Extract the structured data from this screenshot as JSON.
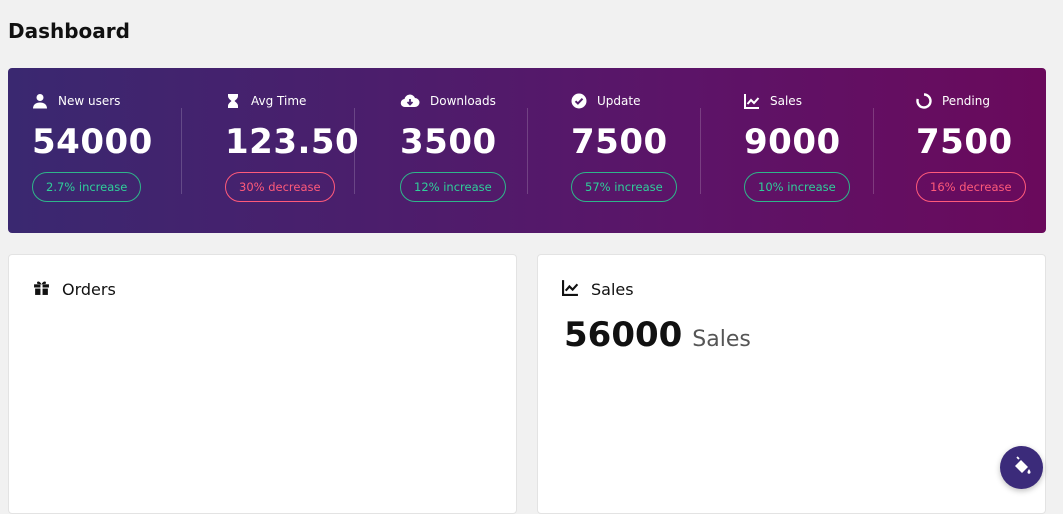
{
  "header": {
    "title": "Dashboard"
  },
  "stats": [
    {
      "icon": "user-icon",
      "label": "New users",
      "value": "54000",
      "badge": "2.7% increase",
      "trend": "up"
    },
    {
      "icon": "hourglass-icon",
      "label": "Avg Time",
      "value": "123.50",
      "badge": "30% decrease",
      "trend": "down"
    },
    {
      "icon": "cloud-download-icon",
      "label": "Downloads",
      "value": "3500",
      "badge": "12% increase",
      "trend": "up"
    },
    {
      "icon": "check-circle-icon",
      "label": "Update",
      "value": "7500",
      "badge": "57% increase",
      "trend": "up"
    },
    {
      "icon": "line-chart-icon",
      "label": "Sales",
      "value": "9000",
      "badge": "10% increase",
      "trend": "up"
    },
    {
      "icon": "spinner-icon",
      "label": "Pending",
      "value": "7500",
      "badge": "16% decrease",
      "trend": "down"
    }
  ],
  "orders_card": {
    "icon": "gift-icon",
    "title": "Orders"
  },
  "sales_card": {
    "icon": "line-chart-icon",
    "title": "Sales",
    "value": "56000",
    "unit": "Sales"
  },
  "fab": {
    "icon": "paint-bucket-icon"
  },
  "colors": {
    "banner_start": "#3a2870",
    "banner_end": "#6a0a5c",
    "increase": "#2fcf9a",
    "decrease": "#ff5a7a",
    "fab": "#3b2b7a"
  }
}
